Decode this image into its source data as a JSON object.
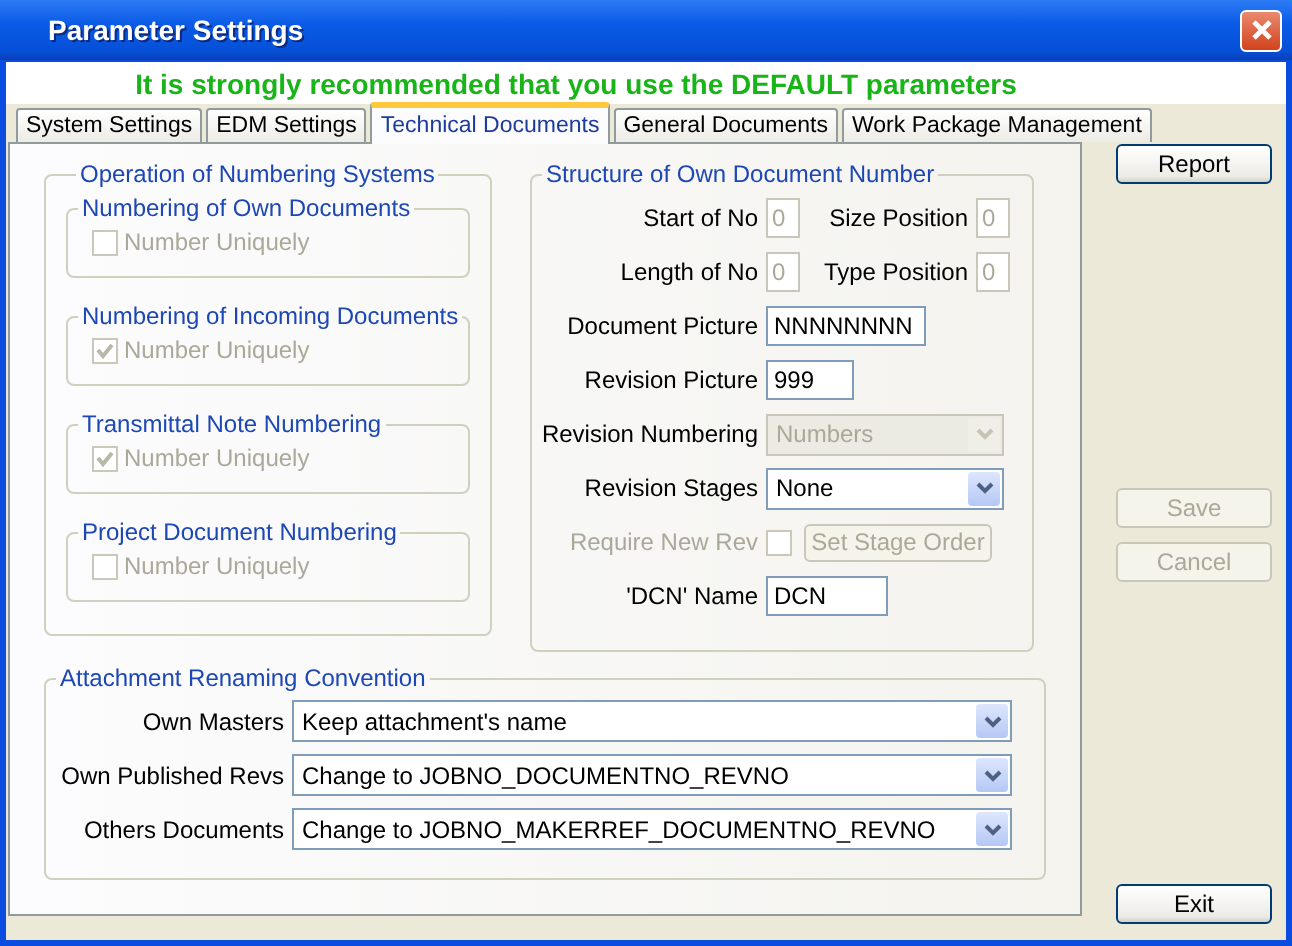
{
  "window": {
    "title": "Parameter Settings"
  },
  "banner": "It is strongly recommended that you use the DEFAULT parameters",
  "tabs": [
    {
      "label": "System Settings",
      "selected": false
    },
    {
      "label": "EDM Settings",
      "selected": false
    },
    {
      "label": "Technical Documents",
      "selected": true
    },
    {
      "label": "General Documents",
      "selected": false
    },
    {
      "label": "Work Package Management",
      "selected": false
    }
  ],
  "numbering_systems": {
    "title": "Operation of Numbering Systems",
    "groups": [
      {
        "title": "Numbering of Own Documents",
        "checkbox": {
          "label": "Number Uniquely",
          "checked": false,
          "disabled": true
        }
      },
      {
        "title": "Numbering of Incoming Documents",
        "checkbox": {
          "label": "Number Uniquely",
          "checked": true,
          "disabled": true
        }
      },
      {
        "title": "Transmittal Note Numbering",
        "checkbox": {
          "label": "Number Uniquely",
          "checked": true,
          "disabled": true
        }
      },
      {
        "title": "Project Document Numbering",
        "checkbox": {
          "label": "Number Uniquely",
          "checked": false,
          "disabled": true
        }
      }
    ]
  },
  "document_number": {
    "title": "Structure of Own Document Number",
    "rows": [
      {
        "items": [
          {
            "kind": "small_field",
            "label": "Start of No",
            "value": "0",
            "disabled": true
          },
          {
            "kind": "small_field",
            "label": "Size Position",
            "value": "0",
            "disabled": true
          }
        ]
      },
      {
        "items": [
          {
            "kind": "small_field",
            "label": "Length of No",
            "value": "0",
            "disabled": true
          },
          {
            "kind": "small_field",
            "label": "Type Position",
            "value": "0",
            "disabled": true
          }
        ]
      },
      {
        "items": [
          {
            "kind": "text_field",
            "label": "Document Picture",
            "value": "NNNNNNNN",
            "disabled": false
          }
        ]
      },
      {
        "items": [
          {
            "kind": "text_field",
            "label": "Revision Picture",
            "value": "999",
            "disabled": false
          }
        ]
      },
      {
        "items": [
          {
            "kind": "dropdown",
            "label": "Revision Numbering",
            "value": "Numbers",
            "disabled": true
          }
        ]
      },
      {
        "items": [
          {
            "kind": "dropdown",
            "label": "Revision Stages",
            "value": "None",
            "disabled": false
          }
        ]
      },
      {
        "items": [
          {
            "kind": "checkbox",
            "label": "Require New Rev",
            "checked": false,
            "disabled": true
          },
          {
            "kind": "button",
            "label": "Set Stage Order",
            "disabled": true
          }
        ]
      },
      {
        "items": [
          {
            "kind": "text_field",
            "label": "'DCN' Name",
            "value": "DCN",
            "disabled": false
          }
        ]
      }
    ]
  },
  "attachment_renaming": {
    "title": "Attachment Renaming Convention",
    "rows": [
      {
        "label": "Own Masters",
        "value": "Keep attachment's name"
      },
      {
        "label": "Own Published Revs",
        "value": "Change to JOBNO_DOCUMENTNO_REVNO"
      },
      {
        "label": "Others Documents",
        "value": "Change to JOBNO_MAKERREF_DOCUMENTNO_REVNO"
      }
    ]
  },
  "button_groups": [
    [
      {
        "label": "Report",
        "disabled": false
      }
    ],
    [
      {
        "label": "Save",
        "disabled": true
      },
      {
        "label": "Cancel",
        "disabled": true
      }
    ],
    [
      {
        "label": "Exit",
        "disabled": false
      }
    ]
  ]
}
